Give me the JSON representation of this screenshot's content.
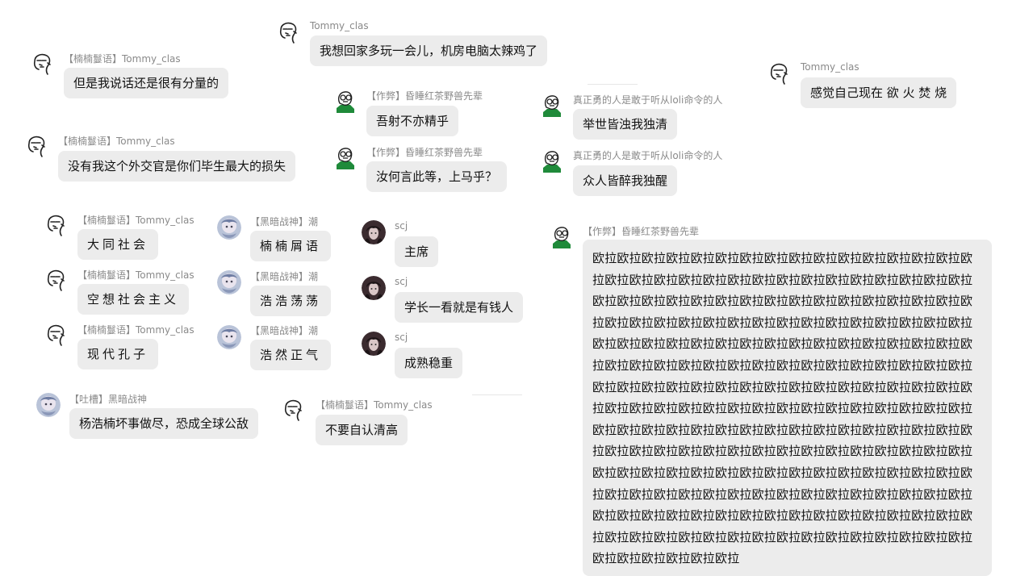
{
  "messages": {
    "m01": {
      "name": "Tommy_clas",
      "text": "我想回家多玩一会儿，机房电脑太辣鸡了"
    },
    "m02": {
      "name": "【楠楠鬘语】Tommy_clas",
      "text": "但是我说话还是很有分量的"
    },
    "m03": {
      "name": "【作弊】昏睡红茶野兽先辈",
      "text": "吾射不亦精乎"
    },
    "m04": {
      "name": "真正勇的人是敢于听从loli命令的人",
      "text": "举世皆浊我独清"
    },
    "m05": {
      "name": "Tommy_clas",
      "text": "感觉自己现在 欲 火 焚 烧"
    },
    "m06": {
      "name": "【楠楠鬘语】Tommy_clas",
      "text": "没有我这个外交官是你们毕生最大的损失"
    },
    "m07": {
      "name": "【作弊】昏睡红茶野兽先辈",
      "text": "汝何言此等，上马乎？"
    },
    "m08": {
      "name": "真正勇的人是敢于听从loli命令的人",
      "text": "众人皆醉我独醒"
    },
    "m09": {
      "name": "【楠楠鬘语】Tommy_clas",
      "text": "大同社会"
    },
    "m10": {
      "name": "【黑暗战神】潮",
      "text": "楠楠屑语"
    },
    "m11": {
      "name": "scj",
      "text": "主席"
    },
    "m12": {
      "name": "【作弊】昏睡红茶野兽先辈",
      "text": "欧拉欧拉欧拉欧拉欧拉欧拉欧拉欧拉欧拉欧拉欧拉欧拉欧拉欧拉欧拉欧拉欧拉欧拉欧拉欧拉欧拉欧拉欧拉欧拉欧拉欧拉欧拉欧拉欧拉欧拉欧拉欧拉欧拉欧拉欧拉欧拉欧拉欧拉欧拉欧拉欧拉欧拉欧拉欧拉欧拉欧拉欧拉欧拉欧拉欧拉欧拉欧拉欧拉欧拉欧拉欧拉欧拉欧拉欧拉欧拉欧拉欧拉欧拉欧拉欧拉欧拉欧拉欧拉欧拉欧拉欧拉欧拉欧拉欧拉欧拉欧拉欧拉欧拉欧拉欧拉欧拉欧拉欧拉欧拉欧拉欧拉欧拉欧拉欧拉欧拉欧拉欧拉欧拉欧拉欧拉欧拉欧拉欧拉欧拉欧拉欧拉欧拉欧拉欧拉欧拉欧拉欧拉欧拉欧拉欧拉欧拉欧拉欧拉欧拉欧拉欧拉欧拉欧拉欧拉欧拉欧拉欧拉欧拉欧拉欧拉欧拉欧拉欧拉欧拉欧拉欧拉欧拉欧拉欧拉欧拉欧拉欧拉欧拉欧拉欧拉欧拉欧拉欧拉欧拉欧拉欧拉欧拉欧拉欧拉欧拉欧拉欧拉欧拉欧拉欧拉欧拉欧拉欧拉欧拉欧拉欧拉欧拉欧拉欧拉欧拉欧拉欧拉欧拉欧拉欧拉欧拉欧拉欧拉欧拉欧拉欧拉欧拉欧拉欧拉欧拉欧拉欧拉欧拉欧拉欧拉欧拉欧拉欧拉欧拉欧拉欧拉欧拉欧拉欧拉欧拉欧拉欧拉欧拉欧拉欧拉欧拉欧拉欧拉欧拉欧拉欧拉欧拉欧拉欧拉欧拉欧拉欧拉欧拉欧拉欧拉欧拉欧拉欧拉欧拉欧拉欧拉欧拉欧拉"
    },
    "m13": {
      "name": "【楠楠鬘语】Tommy_clas",
      "text": "空想社会主义"
    },
    "m14": {
      "name": "【黑暗战神】潮",
      "text": "浩浩荡荡"
    },
    "m15": {
      "name": "scj",
      "text": "学长一看就是有钱人"
    },
    "m16": {
      "name": "【楠楠鬘语】Tommy_clas",
      "text": "现代孔子"
    },
    "m17": {
      "name": "【黑暗战神】潮",
      "text": "浩然正气"
    },
    "m18": {
      "name": "scj",
      "text": "成熟稳重"
    },
    "m19": {
      "name": "【吐槽】黑暗战神",
      "text": "杨浩楠坏事做尽，恐成全球公敌"
    },
    "m20": {
      "name": "【楠楠鬘语】Tommy_clas",
      "text": "不要自认清高"
    }
  },
  "avatar_kinds": {
    "tommy": "sketch-face-icon",
    "beast": "glasses-man-icon",
    "loli": "glasses-man-icon",
    "dark_god": "anime-girl-avatar",
    "scj": "dark-hair-avatar"
  },
  "colors": {
    "bubble_bg": "#ececec",
    "name_text": "#8a8a8a",
    "message_text": "#111111",
    "avatar_green": "#1f8a3a"
  }
}
